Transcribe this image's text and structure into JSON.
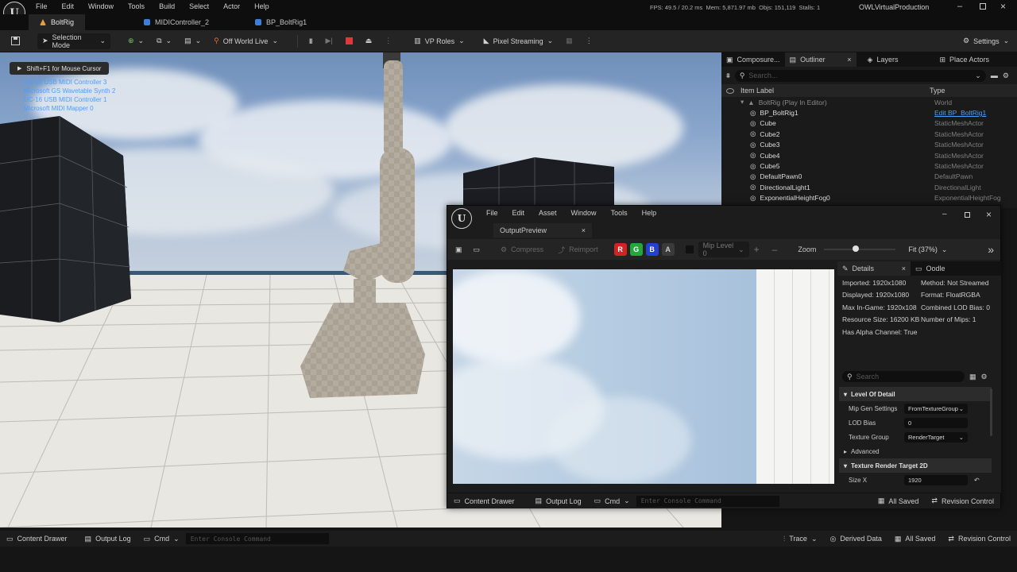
{
  "app": {
    "menu": [
      "File",
      "Edit",
      "Window",
      "Tools",
      "Build",
      "Select",
      "Actor",
      "Help"
    ],
    "stats": "FPS: 49.5 / 20.2 ms  Mem: 5,871.97 mb  Objs: 151,119  Stalls: 1",
    "project": "OWLVirtualProduction",
    "tabs": [
      {
        "label": "BoltRig",
        "color": "#e8a13a"
      },
      {
        "label": "MIDIController_2",
        "color": "#3b7fd8"
      },
      {
        "label": "BP_BoltRig1",
        "color": "#3b7fd8"
      }
    ]
  },
  "toolbar": {
    "selection_mode": "Selection Mode",
    "world": "Off World Live",
    "vp_roles": "VP Roles",
    "pixel_streaming": "Pixel Streaming",
    "settings": "Settings"
  },
  "viewport": {
    "hint": "Shift+F1 for Mouse Cursor",
    "midi_devices": [
      "UC-16 USB MIDI Controller 3",
      "Microsoft GS Wavetable Synth 2",
      "UC-16 USB MIDI Controller 1",
      "Microsoft MIDI Mapper 0"
    ]
  },
  "outliner": {
    "tabs": [
      "Composure...",
      "Outliner",
      "Layers",
      "Place Actors"
    ],
    "search_placeholder": "Search...",
    "col_label": "Item Label",
    "col_type": "Type",
    "root": {
      "label": "BoltRig (Play In Editor)",
      "type": "World"
    },
    "rows": [
      {
        "label": "BP_BoltRig1",
        "type": "Edit BP_BoltRig1",
        "link": true
      },
      {
        "label": "Cube",
        "type": "StaticMeshActor"
      },
      {
        "label": "Cube2",
        "type": "StaticMeshActor"
      },
      {
        "label": "Cube3",
        "type": "StaticMeshActor"
      },
      {
        "label": "Cube4",
        "type": "StaticMeshActor"
      },
      {
        "label": "Cube5",
        "type": "StaticMeshActor"
      },
      {
        "label": "DefaultPawn0",
        "type": "DefaultPawn"
      },
      {
        "label": "DirectionalLight1",
        "type": "DirectionalLight"
      },
      {
        "label": "ExponentialHeightFog0",
        "type": "ExponentialHeightFog"
      }
    ]
  },
  "texture_editor": {
    "menu": [
      "File",
      "Edit",
      "Asset",
      "Window",
      "Tools",
      "Help"
    ],
    "tab": "OutputPreview",
    "compress": "Compress",
    "reimport": "Reimport",
    "channels": [
      {
        "label": "R",
        "color": "#d02424"
      },
      {
        "label": "G",
        "color": "#22a83a"
      },
      {
        "label": "B",
        "color": "#2440d0"
      },
      {
        "label": "A",
        "color": "#4a4a4a"
      }
    ],
    "mip": "Mip Level 0",
    "zoom_label": "Zoom",
    "fit": "Fit (37%)",
    "details_tab": "Details",
    "oodle_tab": "Oodle",
    "info_left": [
      "Imported: 1920x1080",
      "Displayed: 1920x1080",
      "Max In-Game: 1920x108",
      "Resource Size: 16200 KB",
      "Has Alpha Channel: True"
    ],
    "info_right": [
      "Method: Not Streamed",
      "Format: FloatRGBA",
      "Combined LOD Bias: 0",
      "Number of Mips: 1"
    ],
    "search_placeholder": "Search",
    "sections": {
      "lod": "Level Of Detail",
      "advanced": "Advanced",
      "rt2d": "Texture Render Target 2D"
    },
    "props": [
      {
        "name": "Mip Gen Settings",
        "value": "FromTextureGroup",
        "dropdown": true
      },
      {
        "name": "LOD Bias",
        "value": "0",
        "dropdown": false
      },
      {
        "name": "Texture Group",
        "value": "RenderTarget",
        "dropdown": true
      }
    ],
    "size_x": {
      "name": "Size X",
      "value": "1920"
    },
    "status": {
      "content_drawer": "Content Drawer",
      "output_log": "Output Log",
      "cmd": "Cmd",
      "console_placeholder": "Enter Console Command",
      "all_saved": "All Saved",
      "revision": "Revision Control"
    }
  },
  "statusbar": {
    "content_drawer": "Content Drawer",
    "output_log": "Output Log",
    "cmd": "Cmd",
    "console_placeholder": "Enter Console Command",
    "trace": "Trace",
    "derived_data": "Derived Data",
    "all_saved": "All Saved",
    "revision": "Revision Control"
  }
}
